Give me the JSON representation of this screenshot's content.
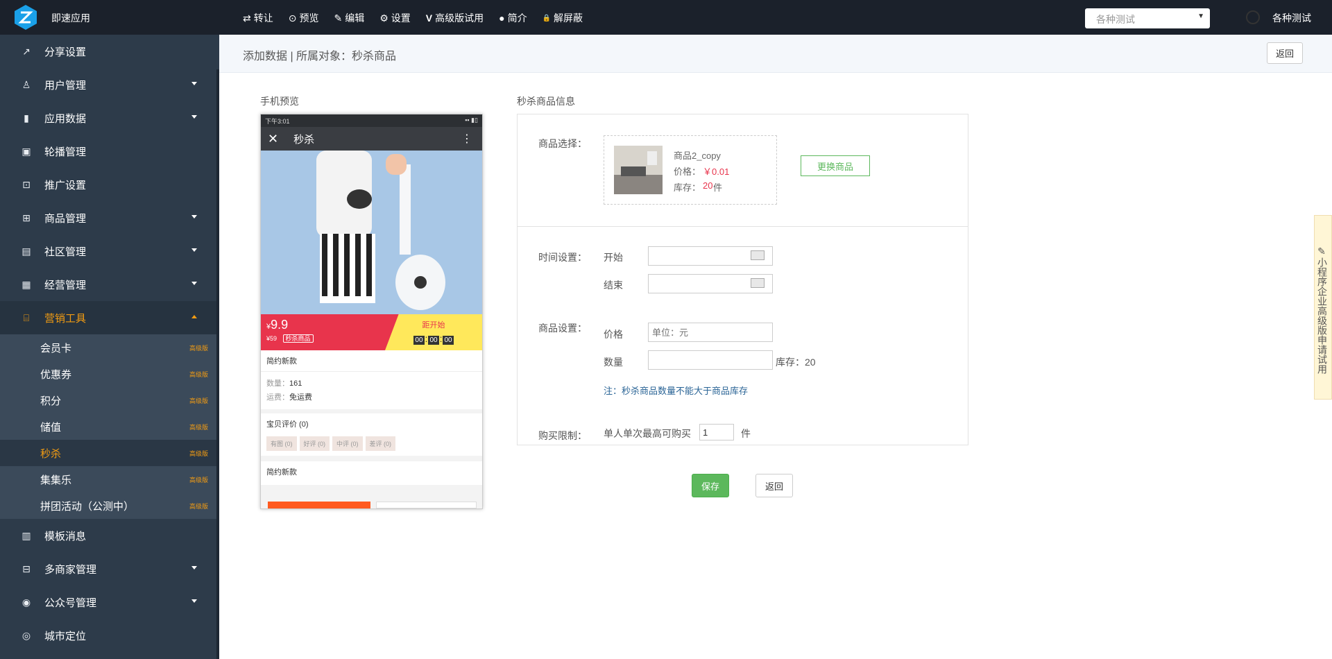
{
  "topbar": {
    "app_name": "即速应用",
    "nav": [
      {
        "icon": "⇄",
        "label": "转让"
      },
      {
        "icon": "⊙",
        "label": "预览"
      },
      {
        "icon": "✎",
        "label": "编辑"
      },
      {
        "icon": "⚙",
        "label": "设置"
      },
      {
        "icon": "V",
        "label": "高级版试用"
      },
      {
        "icon": "●",
        "label": "简介"
      },
      {
        "icon": "🔒",
        "label": "解屏蔽"
      }
    ],
    "select_value": "各种测试",
    "user_name": "各种测试"
  },
  "sidebar": {
    "items": [
      {
        "label": "分享设置",
        "icon": "share-icon",
        "has_caret": false
      },
      {
        "label": "用户管理",
        "icon": "user-icon",
        "has_caret": true
      },
      {
        "label": "应用数据",
        "icon": "bar-chart-icon",
        "has_caret": true
      },
      {
        "label": "轮播管理",
        "icon": "image-icon",
        "has_caret": false
      },
      {
        "label": "推广设置",
        "icon": "promote-icon",
        "has_caret": false
      },
      {
        "label": "商品管理",
        "icon": "goods-icon",
        "has_caret": true
      },
      {
        "label": "社区管理",
        "icon": "community-icon",
        "has_caret": true
      },
      {
        "label": "经营管理",
        "icon": "business-icon",
        "has_caret": true
      },
      {
        "label": "营销工具",
        "icon": "gift-icon",
        "has_caret": true,
        "active": true
      }
    ],
    "sub_items": [
      {
        "label": "会员卡",
        "badge": "高级版"
      },
      {
        "label": "优惠券",
        "badge": "高级版"
      },
      {
        "label": "积分",
        "badge": "高级版"
      },
      {
        "label": "储值",
        "badge": "高级版"
      },
      {
        "label": "秒杀",
        "badge": "高级版",
        "active": true
      },
      {
        "label": "集集乐",
        "badge": "高级版"
      },
      {
        "label": "拼团活动（公测中）",
        "badge": "高级版"
      }
    ],
    "bottom_items": [
      {
        "label": "模板消息",
        "icon": "template-icon",
        "has_caret": false
      },
      {
        "label": "多商家管理",
        "icon": "shop-icon",
        "has_caret": true
      },
      {
        "label": "公众号管理",
        "icon": "wechat-icon",
        "has_caret": true
      },
      {
        "label": "城市定位",
        "icon": "location-icon",
        "has_caret": false
      }
    ]
  },
  "header": {
    "title": "添加数据 | 所属对象：秒杀商品",
    "back_label": "返回"
  },
  "preview": {
    "title": "手机预览",
    "status_time": "下午3:01",
    "nav_title": "秒杀",
    "price": "9.9",
    "currency": "¥",
    "old_price": "¥59",
    "flag": "秒杀商品",
    "countdown_label": "距开始",
    "countdown": [
      "00",
      "00",
      "00"
    ],
    "product_name": "简约新款",
    "qty_label": "数量：",
    "qty": "161",
    "ship_label": "运费：",
    "ship": "免运费",
    "review_title": "宝贝评价 (0)",
    "review_tags": [
      "有图 (0)",
      "好评 (0)",
      "中评 (0)",
      "差评 (0)"
    ],
    "detail_title": "简约新款"
  },
  "form": {
    "section_title": "秒杀商品信息",
    "goods_label": "商品选择：",
    "goods_name": "商品2_copy",
    "price_label": "价格：",
    "goods_price": "￥0.01",
    "stock_label": "库存：",
    "goods_stock": "20",
    "stock_unit": "件",
    "change_button": "更换商品",
    "time_label": "时间设置：",
    "start_label": "开始",
    "end_label": "结束",
    "start_value": "",
    "end_value": "",
    "goods_setting_label": "商品设置：",
    "price_field_label": "价格",
    "price_placeholder": "单位：元",
    "qty_field_label": "数量",
    "stock_note": "库存：20",
    "note": "注：秒杀商品数量不能大于商品库存",
    "limit_label": "购买限制：",
    "limit_text": "单人单次最高可购买",
    "limit_value": "1",
    "limit_unit": "件"
  },
  "actions": {
    "save": "保存",
    "back": "返回"
  },
  "feedback": "小程序企业高级版申请试用",
  "colors": {
    "accent": "#f39c12",
    "sidebar": "#2d3b4a",
    "save": "#5cb85c",
    "price_red": "#e8344c"
  }
}
